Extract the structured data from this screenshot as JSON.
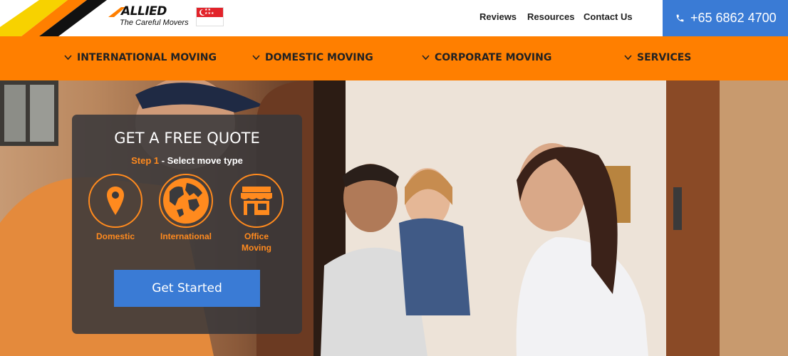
{
  "brand": {
    "logo_word": "ALLIED",
    "tagline": "The Careful Movers",
    "flag_icon": "singapore-flag-icon"
  },
  "header": {
    "links": [
      "Reviews",
      "Resources",
      "Contact Us"
    ],
    "phone": "+65 6862 4700",
    "phone_icon": "phone-icon"
  },
  "nav": {
    "items": [
      "INTERNATIONAL MOVING",
      "DOMESTIC MOVING",
      "CORPORATE MOVING",
      "SERVICES"
    ]
  },
  "quote": {
    "title": "GET A FREE QUOTE",
    "step_prefix": "Step 1",
    "step_text": " - Select move type",
    "options": [
      {
        "label": "Domestic",
        "icon": "map-pin-icon"
      },
      {
        "label": "International",
        "icon": "globe-icon"
      },
      {
        "label": "Office Moving",
        "icon": "storefront-icon"
      }
    ],
    "cta": "Get Started"
  },
  "colors": {
    "accent_orange": "#ff7f00",
    "accent_blue": "#3a7bd5",
    "card_bg": "#37373a"
  }
}
